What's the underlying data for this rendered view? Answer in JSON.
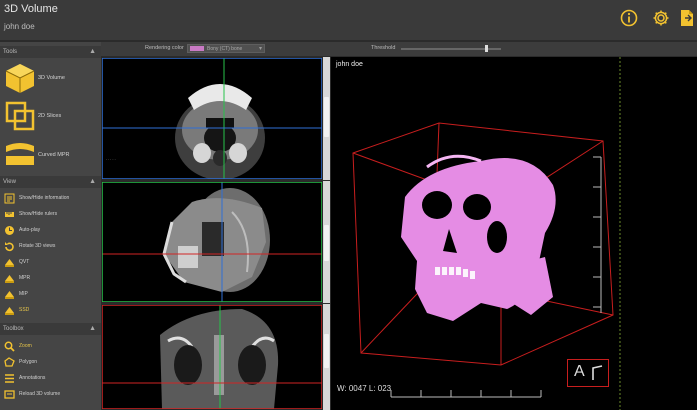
{
  "app": {
    "title": "3D Volume",
    "patient": "john doe"
  },
  "colors": {
    "accent": "#f2c230",
    "bg": "#2b2b2b",
    "panel": "#454545",
    "crosshair_blue": "#2f6fd6",
    "crosshair_green": "#27c24a",
    "crosshair_red": "#d02424",
    "bone": "#e58ce4"
  },
  "top_icons": [
    "info-icon",
    "gear-icon",
    "export-icon"
  ],
  "sections": {
    "tools": {
      "label": "Tools"
    },
    "view": {
      "label": "View"
    },
    "toolbox": {
      "label": "Toolbox"
    }
  },
  "modes": [
    {
      "label": "3D Volume",
      "icon": "cube-icon"
    },
    {
      "label": "2D Slices",
      "icon": "slices-icon"
    },
    {
      "label": "Curved MPR",
      "icon": "curved-mpr-icon"
    }
  ],
  "view_items": [
    {
      "label": "Show/Hide information",
      "icon": "info-list-icon"
    },
    {
      "label": "Show/Hide rulers",
      "icon": "ruler-icon"
    },
    {
      "label": "Auto-play",
      "icon": "clock-icon"
    },
    {
      "label": "Rotate 3D views",
      "icon": "rotate-icon"
    },
    {
      "label": "QVT",
      "icon": "qvt-icon"
    },
    {
      "label": "MPR",
      "icon": "mpr-icon"
    },
    {
      "label": "MIP",
      "icon": "mip-icon"
    },
    {
      "label": "SSD",
      "icon": "ssd-icon"
    }
  ],
  "toolbox_items": [
    {
      "label": "Zoom",
      "icon": "zoom-icon"
    },
    {
      "label": "Polygon",
      "icon": "polygon-icon"
    },
    {
      "label": "Annotations",
      "icon": "annotations-icon"
    },
    {
      "label": "Reload 3D volume",
      "icon": "reload-icon"
    }
  ],
  "toolbar": {
    "rendering_label": "Rendering color",
    "rendering_value": "Bony (CT) bone",
    "threshold_label": "Threshold",
    "threshold_level": 0.85
  },
  "view3d": {
    "name": "john doe",
    "wl": "W: 0047 L: 023"
  },
  "orientation": {
    "label": "A"
  }
}
